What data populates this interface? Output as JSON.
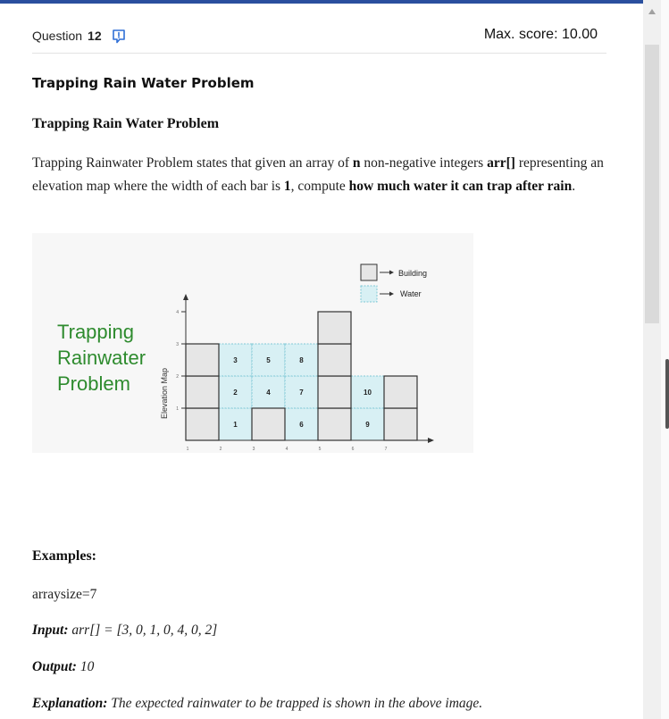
{
  "question": {
    "label": "Question",
    "number": "12",
    "max_score": "Max. score: 10.00",
    "title": "Trapping Rain Water Problem"
  },
  "problem": {
    "heading": "Trapping Rain Water Problem",
    "desc_part1": "Trapping Rainwater Problem states that given an array of ",
    "desc_n": "n",
    "desc_part2": " non-negative integers ",
    "desc_arr": "arr[]",
    "desc_part3": " representing an elevation map where the width of each bar is ",
    "desc_one": "1",
    "desc_part4": ", compute ",
    "desc_bold_end": "how much water it can trap after rain",
    "desc_period": "."
  },
  "figure": {
    "title_line1": "Trapping",
    "title_line2": "Rainwater",
    "title_line3": "Problem",
    "y_axis_label": "Elevation Map",
    "legend_building": "Building",
    "legend_water": "Water",
    "heights": [
      3,
      0,
      1,
      0,
      4,
      0,
      2
    ],
    "water_labels": [
      "1",
      "2",
      "3",
      "4",
      "5",
      "6",
      "7",
      "8",
      "9",
      "10"
    ],
    "y_ticks": [
      "1",
      "2",
      "3",
      "4"
    ],
    "x_ticks": [
      "1",
      "2",
      "3",
      "4",
      "5",
      "6",
      "7"
    ],
    "colors": {
      "title_green": "#2e8b2e",
      "building_fill": "#e6e6e6",
      "water_fill": "#d8f0f4",
      "water_border": "#7fc8d6"
    }
  },
  "examples": {
    "heading": "Examples:",
    "arraysize": "arraysize=7",
    "input_label": "Input:",
    "input_value": " arr[] = [3, 0, 1, 0, 4, 0, 2]",
    "output_label": "Output:",
    "output_value": " 10",
    "explanation_label": "Explanation:",
    "explanation_value": " The expected rainwater to be trapped is shown in the above image."
  }
}
